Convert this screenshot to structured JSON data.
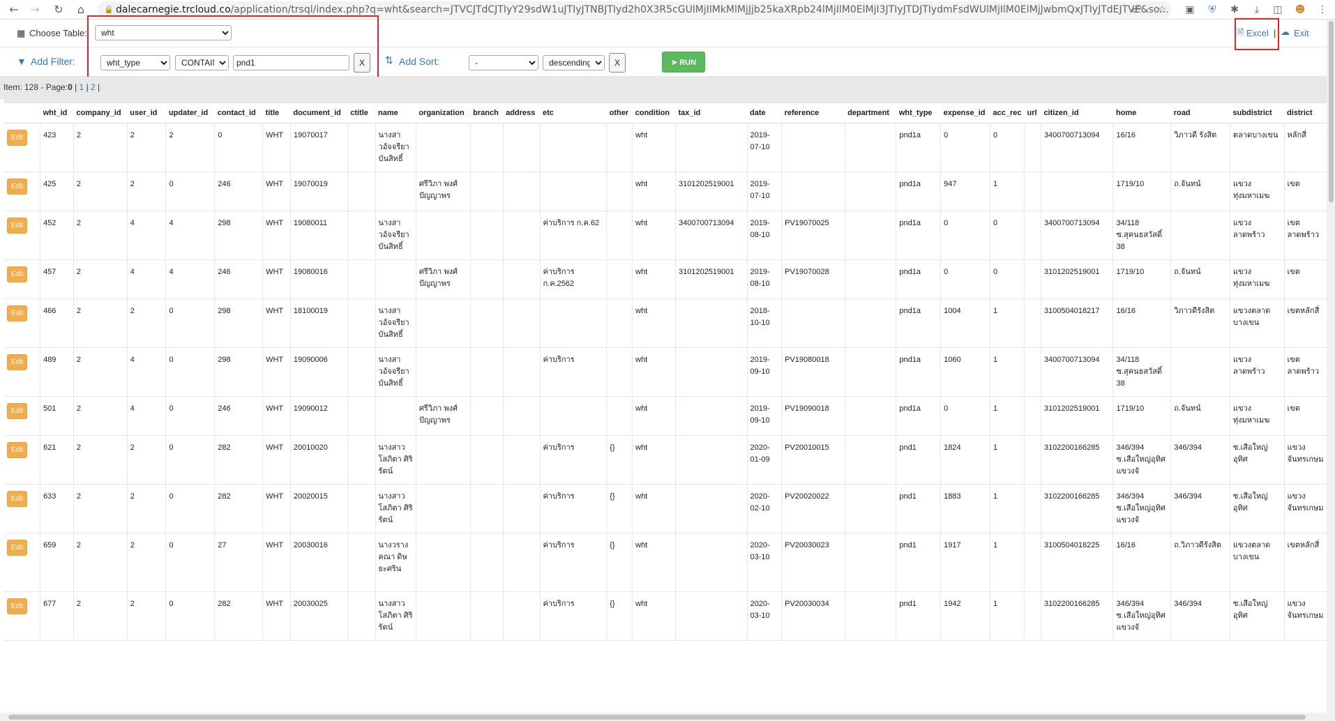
{
  "browser": {
    "url_host": "dalecarnegie.trcloud.co",
    "url_path": "/application/trsql/index.php?q=wht&search=JTVCJTdCJTIyY29sdW1uJTIyJTNBJTIyd2h0X3R5cGUlMjIlMkMlMjJjb25kaXRpb24lMjIlM0ElMjI3JTIyJTDJTIydmFsdWUlMjIlM0ElMjJwbmQxJTIyJTdEJTVE&so..."
  },
  "toolbar": {
    "choose_table_label": "Choose Table:",
    "table_value": "wht",
    "add_filter_label": "Add Filter:",
    "filter_column": "wht_type",
    "filter_condition": "CONTAIN",
    "filter_value": "pnd1",
    "filter_remove": "X",
    "add_sort_label": "Add Sort:",
    "sort_column": "-",
    "sort_direction": "descending",
    "sort_remove": "X",
    "run_label": "RUN",
    "excel_label": "Excel",
    "separator": "|",
    "exit_label": "Exit"
  },
  "status": {
    "items_text": "Item: 128 - Page:",
    "current_page": "0",
    "sep1": " | ",
    "page1": "1",
    "sep2": " | ",
    "page2": "2",
    "sep3": " |"
  },
  "table": {
    "edit_label": "Edit",
    "columns": [
      "",
      "wht_id",
      "company_id",
      "user_id",
      "updater_id",
      "contact_id",
      "title",
      "document_id",
      "ctitle",
      "name",
      "organization",
      "branch",
      "address",
      "etc",
      "other",
      "condition",
      "tax_id",
      "date",
      "reference",
      "department",
      "wht_type",
      "expense_id",
      "acc_rec",
      "url",
      "citizen_id",
      "home",
      "road",
      "subdistrict",
      "district"
    ],
    "rows": [
      [
        "423",
        "2",
        "2",
        "2",
        "0",
        "WHT",
        "19070017",
        "",
        "นางสาวอัจจรียา บันสิทธิ์",
        "",
        "",
        "",
        "",
        "",
        "wht",
        "",
        "2019-07-10",
        "",
        "",
        "pnd1a",
        "0",
        "0",
        "",
        "3400700713094",
        "16/16",
        "วิภาวดี รังสิต",
        "ตลาดบางเขน",
        "หลักสี่"
      ],
      [
        "425",
        "2",
        "2",
        "0",
        "246",
        "WHT",
        "19070019",
        "",
        "",
        "ศรีวิภา พงศ์ปัญญาพร",
        "",
        "",
        "",
        "",
        "wht",
        "3101202519001",
        "2019-07-10",
        "",
        "",
        "pnd1a",
        "947",
        "1",
        "",
        "",
        "1719/10",
        "ถ.จันทน์",
        "แขวงทุ่งมหาเมฆ",
        "เขต"
      ],
      [
        "452",
        "2",
        "4",
        "4",
        "298",
        "WHT",
        "19080011",
        "",
        "นางสาวอัจจรียา บันสิทธิ์",
        "",
        "",
        "",
        "ค่าบริการ ก.ค.62",
        "",
        "wht",
        "3400700713094",
        "2019-08-10",
        "PV19070025",
        "",
        "pnd1a",
        "0",
        "0",
        "",
        "3400700713094",
        "34/118 ซ.สุคนธสวัสดิ์ 38",
        "",
        "แขวงลาดพร้าว",
        "เขตลาดพร้าว"
      ],
      [
        "457",
        "2",
        "4",
        "4",
        "246",
        "WHT",
        "19080016",
        "",
        "",
        "ศรีวิภา พงศ์ปัญญาพร",
        "",
        "",
        "ค่าบริการ ก.ค.2562",
        "",
        "wht",
        "3101202519001",
        "2019-08-10",
        "PV19070028",
        "",
        "pnd1a",
        "0",
        "0",
        "",
        "3101202519001",
        "1719/10",
        "ถ.จันทน์",
        "แขวงทุ่งมหาเมฆ",
        "เขต"
      ],
      [
        "466",
        "2",
        "2",
        "0",
        "298",
        "WHT",
        "18100019",
        "",
        "นางสาวอัจจรียา บันสิทธิ์",
        "",
        "",
        "",
        "",
        "",
        "wht",
        "",
        "2018-10-10",
        "",
        "",
        "pnd1a",
        "1004",
        "1",
        "",
        "3100504018217",
        "16/16",
        "วิภาวดีรังสิต",
        "แขวงตลาดบางเขน",
        "เขตหลักสี่"
      ],
      [
        "489",
        "2",
        "4",
        "0",
        "298",
        "WHT",
        "19090006",
        "",
        "นางสาวอัจจรียา บันสิทธิ์",
        "",
        "",
        "",
        "ค่าบริการ",
        "",
        "wht",
        "",
        "2019-09-10",
        "PV19080018",
        "",
        "pnd1a",
        "1060",
        "1",
        "",
        "3400700713094",
        "34/118 ซ.สุคนธสวัสดิ์ 38",
        "",
        "แขวงลาดพร้าว",
        "เขตลาดพร้าว"
      ],
      [
        "501",
        "2",
        "4",
        "0",
        "246",
        "WHT",
        "19090012",
        "",
        "",
        "ศรีวิภา พงศ์ปัญญาพร",
        "",
        "",
        "",
        "",
        "wht",
        "",
        "2019-09-10",
        "PV19090018",
        "",
        "pnd1a",
        "0",
        "1",
        "",
        "3101202519001",
        "1719/10",
        "ถ.จันทน์",
        "แขวงทุ่งมหาเมฆ",
        "เขต"
      ],
      [
        "621",
        "2",
        "2",
        "0",
        "282",
        "WHT",
        "20010020",
        "",
        "นางสาวโสภิตา ศิริรัตน์",
        "",
        "",
        "",
        "ค่าบริการ",
        "{}",
        "wht",
        "",
        "2020-01-09",
        "PV20010015",
        "",
        "pnd1",
        "1824",
        "1",
        "",
        "3102200166285",
        "346/394 ซ.เสือใหญ่อุทิศ แขวงจั",
        "346/394",
        "ซ.เสือใหญ่อุทิศ",
        "แขวงจันทรเกษม"
      ],
      [
        "633",
        "2",
        "2",
        "0",
        "282",
        "WHT",
        "20020015",
        "",
        "นางสาวโสภิตา ศิริรัตน์",
        "",
        "",
        "",
        "ค่าบริการ",
        "{}",
        "wht",
        "",
        "2020-02-10",
        "PV20020022",
        "",
        "pnd1",
        "1883",
        "1",
        "",
        "3102200166285",
        "346/394 ซ.เสือใหญ่อุทิศ แขวงจั",
        "346/394",
        "ซ.เสือใหญ่อุทิศ",
        "แขวงจันทรเกษม"
      ],
      [
        "659",
        "2",
        "2",
        "0",
        "27",
        "WHT",
        "20030016",
        "",
        "นางวรางคณา ดิษยะศริน",
        "",
        "",
        "",
        "ค่าบริการ",
        "{}",
        "wht",
        "",
        "2020-03-10",
        "PV20030023",
        "",
        "pnd1",
        "1917",
        "1",
        "",
        "3100504018225",
        "16/16",
        "ถ.วิภาวดีรังสิต",
        "แขวงตลาดบางเขน",
        "เขตหลักสี่"
      ],
      [
        "677",
        "2",
        "2",
        "0",
        "282",
        "WHT",
        "20030025",
        "",
        "นางสาวโสภิตา ศิริรัตน์",
        "",
        "",
        "",
        "ค่าบริการ",
        "{}",
        "wht",
        "",
        "2020-03-10",
        "PV20030034",
        "",
        "pnd1",
        "1942",
        "1",
        "",
        "3102200166285",
        "346/394 ซ.เสือใหญ่อุทิศ แขวงจั",
        "346/394",
        "ซ.เสือใหญ่อุทิศ",
        "แขวงจันทรเกษม"
      ]
    ]
  }
}
